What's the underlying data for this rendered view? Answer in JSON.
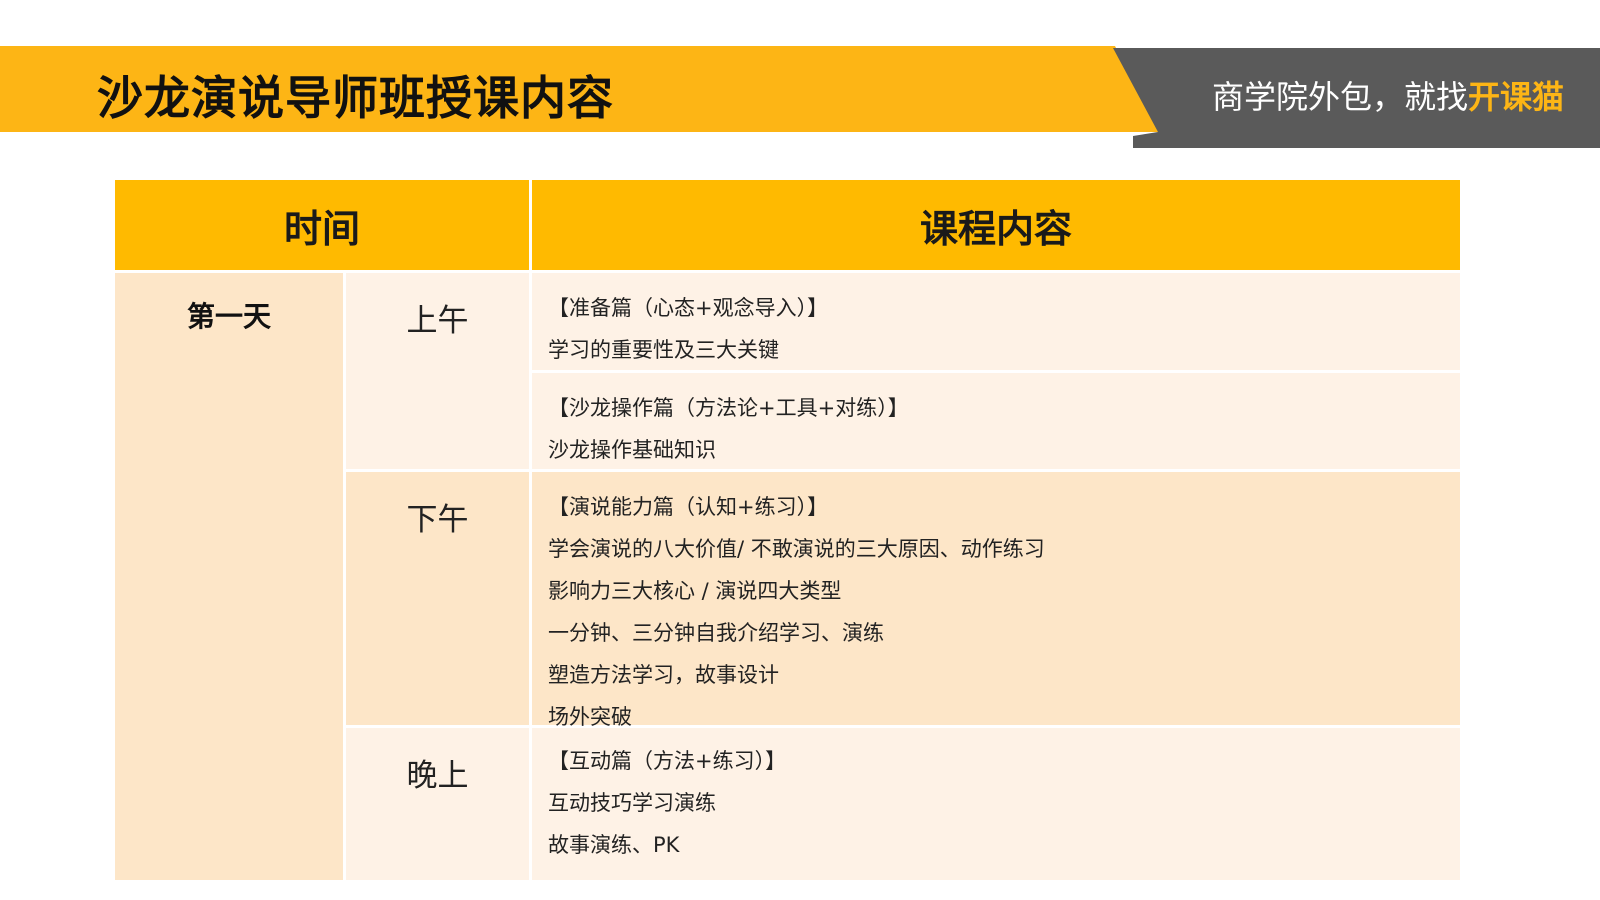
{
  "header": {
    "title": "沙龙演说导师班授课内容",
    "slogan_prefix": "商学院外包，就找",
    "slogan_brand": "开课猫"
  },
  "table": {
    "col_time": "时间",
    "col_content": "课程内容",
    "day": "第一天",
    "periods": {
      "morning": "上午",
      "afternoon": "下午",
      "evening": "晚上"
    },
    "sections": [
      {
        "lines": [
          "【准备篇（心态+观念导入）】",
          "学习的重要性及三大关键"
        ]
      },
      {
        "lines": [
          "【沙龙操作篇（方法论+工具+对练）】",
          "沙龙操作基础知识"
        ]
      },
      {
        "lines": [
          "【演说能力篇（认知+练习）】",
          "学会演说的八大价值/ 不敢演说的三大原因、动作练习",
          "影响力三大核心 /  演说四大类型",
          "一分钟、三分钟自我介绍学习、演练",
          "塑造方法学习，故事设计",
          "场外突破"
        ]
      },
      {
        "lines": [
          "【互动篇（方法+练习）】",
          "互动技巧学习演练",
          "故事演练、PK"
        ]
      }
    ]
  },
  "colors": {
    "banner_yellow": "#FDB515",
    "banner_dark": "#5a5a5a",
    "header_yellow": "#FFBA00",
    "row_light": "#FEF2E6",
    "row_dark": "#FDE6C8"
  }
}
